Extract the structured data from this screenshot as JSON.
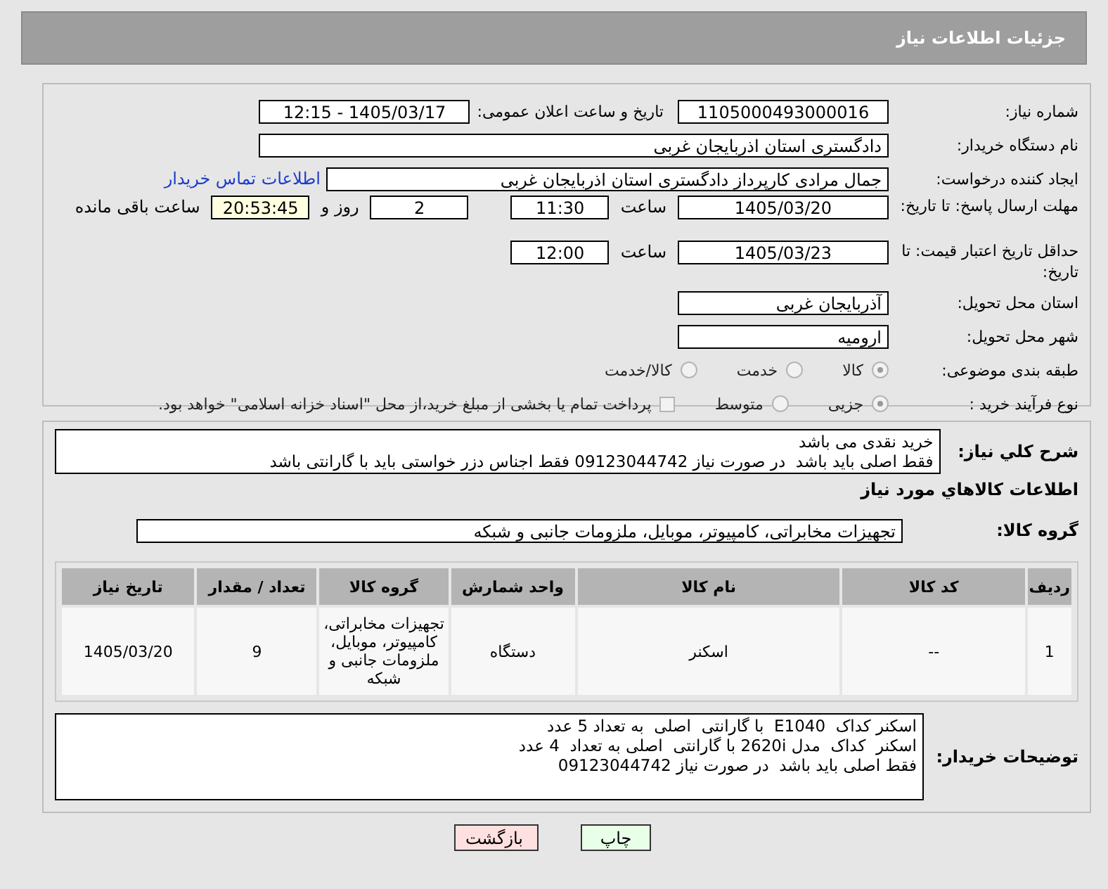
{
  "title": "جزئیات اطلاعات نیاز",
  "need_number": {
    "label": "شماره نیاز:",
    "value": "1105000493000016"
  },
  "announce": {
    "label": "تاریخ و ساعت اعلان عمومی:",
    "value": "1405/03/17 - 12:15"
  },
  "buyer_org": {
    "label": "نام دستگاه خریدار:",
    "value": "دادگستری استان اذربایجان غربی"
  },
  "requester": {
    "label": "ایجاد کننده درخواست:",
    "value": "جمال مرادی کارپرداز دادگستری استان اذربایجان غربی",
    "link": "اطلاعات تماس خریدار"
  },
  "deadline": {
    "label": "مهلت ارسال پاسخ: تا تاریخ:",
    "date": "1405/03/20",
    "time_label": "ساعت",
    "time": "11:30",
    "days": "2",
    "days_label": "روز و",
    "remaining": "20:53:45",
    "remaining_label": "ساعت باقی مانده"
  },
  "price_validity": {
    "label": "حداقل تاریخ اعتبار قیمت: تا تاریخ:",
    "date": "1405/03/23",
    "time_label": "ساعت",
    "time": "12:00"
  },
  "province": {
    "label": "استان محل تحویل:",
    "value": "آذربایجان غربی"
  },
  "city": {
    "label": "شهر محل تحویل:",
    "value": "ارومیه"
  },
  "category": {
    "label": "طبقه بندی موضوعی:",
    "options": [
      {
        "label": "کالا",
        "selected": true
      },
      {
        "label": "خدمت",
        "selected": false
      },
      {
        "label": "کالا/خدمت",
        "selected": false
      }
    ]
  },
  "process": {
    "label": "نوع فرآیند خرید :",
    "options": [
      {
        "label": "جزیی",
        "selected": true
      },
      {
        "label": "متوسط",
        "selected": false
      }
    ],
    "payment_note": {
      "checked": false,
      "text": "پرداخت تمام یا بخشی از مبلغ خرید،از محل \"اسناد خزانه اسلامی\" خواهد بود."
    }
  },
  "description": {
    "label": "شرح کلي نياز:",
    "lines": [
      "خرید نقدی می باشد",
      "فقط اصلی باید باشد  در صورت نیاز 09123044742 فقط اجناس دزر خواستی باید با گارانتی باشد"
    ]
  },
  "goods_heading": "اطلاعات کالاهاي مورد نياز",
  "goods_group": {
    "label": "گروه کالا:",
    "value": "تجهیزات مخابراتی، کامپیوتر، موبایل، ملزومات جانبی و شبکه"
  },
  "table": {
    "columns": [
      "ردیف",
      "کد کالا",
      "نام کالا",
      "واحد شمارش",
      "گروه کالا",
      "تعداد / مقدار",
      "تاریخ نیاز"
    ],
    "rows": [
      [
        "1",
        "--",
        "اسکنر",
        "دستگاه",
        "تجهیزات مخابراتی، کامپیوتر، موبایل، ملزومات جانبی و شبکه",
        "9",
        "1405/03/20"
      ]
    ]
  },
  "buyer_notes": {
    "label": "توضیحات خریدار:",
    "lines": [
      "اسکنر کداک  E1040  با گارانتی  اصلی  به تعداد 5 عدد",
      "اسکنر  کداک  مدل 2620i با گارانتی  اصلی به تعداد  4 عدد",
      "فقط اصلی باید باشد  در صورت نیاز 09123044742"
    ]
  },
  "buttons": [
    {
      "kind": "print",
      "label": "چاپ"
    },
    {
      "kind": "back",
      "label": "بازگشت"
    }
  ]
}
